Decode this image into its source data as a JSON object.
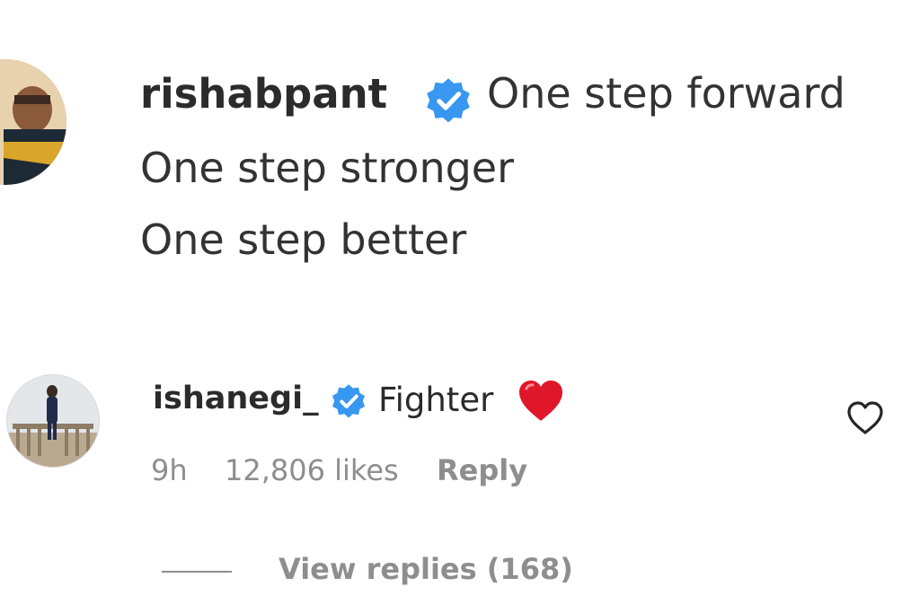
{
  "post_caption": {
    "username": "rishabpant",
    "verified_icon": "verified-badge-icon",
    "lines": [
      "One step forward",
      "One step stronger",
      "One step better"
    ]
  },
  "comment": {
    "username": "ishanegi_",
    "verified_icon": "verified-badge-icon",
    "text": "Fighter",
    "emoji_icon": "red-heart-emoji-icon",
    "time": "9h",
    "likes": "12,806 likes",
    "reply_label": "Reply",
    "like_icon": "heart-outline-icon",
    "view_replies_label": "View replies (168)"
  },
  "colors": {
    "verified_blue": "#3897f0",
    "text_primary": "#262626",
    "text_secondary": "#8e8e8e",
    "heart_red": "#e0162b"
  }
}
